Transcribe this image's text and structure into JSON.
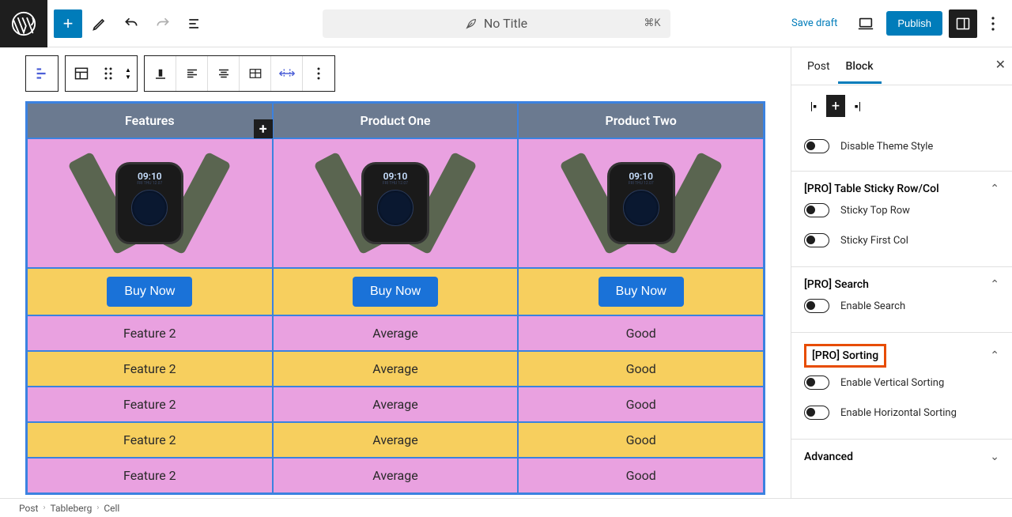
{
  "header": {
    "document_title": "No Title",
    "kbd_hint": "⌘K",
    "save_draft": "Save draft",
    "publish": "Publish"
  },
  "table": {
    "headers": [
      "Features",
      "Product One",
      "Product Two"
    ],
    "watch_time": "09:10",
    "buy_label": "Buy Now",
    "rows": [
      {
        "c1": "Feature 2",
        "c2": "Average",
        "c3": "Good"
      },
      {
        "c1": "Feature 2",
        "c2": "Average",
        "c3": "Good"
      },
      {
        "c1": "Feature 2",
        "c2": "Average",
        "c3": "Good"
      },
      {
        "c1": "Feature 2",
        "c2": "Average",
        "c3": "Good"
      },
      {
        "c1": "Feature 2",
        "c2": "Average",
        "c3": "Good"
      }
    ]
  },
  "sidebar": {
    "tabs": {
      "post": "Post",
      "block": "Block"
    },
    "disable_theme": "Disable Theme Style",
    "sticky": {
      "title": "[PRO] Table Sticky Row/Col",
      "top_row": "Sticky Top Row",
      "first_col": "Sticky First Col"
    },
    "search": {
      "title": "[PRO] Search",
      "enable": "Enable Search"
    },
    "sorting": {
      "title": "[PRO] Sorting",
      "vertical": "Enable Vertical Sorting",
      "horizontal": "Enable Horizontal Sorting"
    },
    "advanced": "Advanced"
  },
  "breadcrumb": {
    "a": "Post",
    "b": "Tableberg",
    "c": "Cell"
  }
}
